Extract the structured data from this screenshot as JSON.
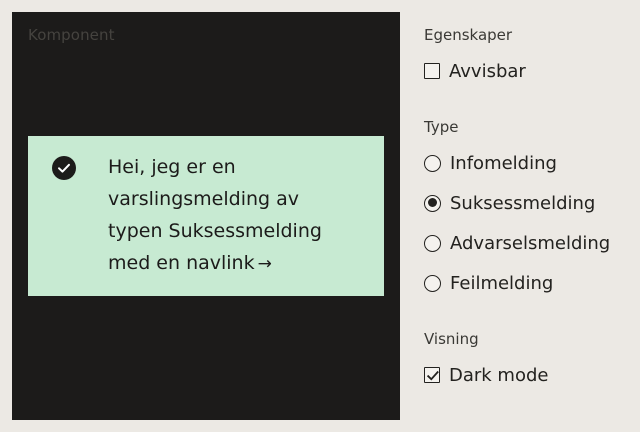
{
  "preview": {
    "label": "Komponent",
    "alert": {
      "text": "Hei, jeg er en varslingsmelding av typen Suksessmelding",
      "link_label": "med en navlink",
      "arrow": "→",
      "icon": "check-circle-icon",
      "background": "#c7ead2"
    },
    "background": "#1c1b1a"
  },
  "panel": {
    "properties": {
      "title": "Egenskaper",
      "dismissable": {
        "label": "Avvisbar",
        "checked": false
      }
    },
    "type": {
      "title": "Type",
      "options": [
        {
          "label": "Infomelding",
          "selected": false
        },
        {
          "label": "Suksessmelding",
          "selected": true
        },
        {
          "label": "Advarselsmelding",
          "selected": false
        },
        {
          "label": "Feilmelding",
          "selected": false
        }
      ]
    },
    "view": {
      "title": "Visning",
      "dark_mode": {
        "label": "Dark mode",
        "checked": true
      }
    }
  }
}
